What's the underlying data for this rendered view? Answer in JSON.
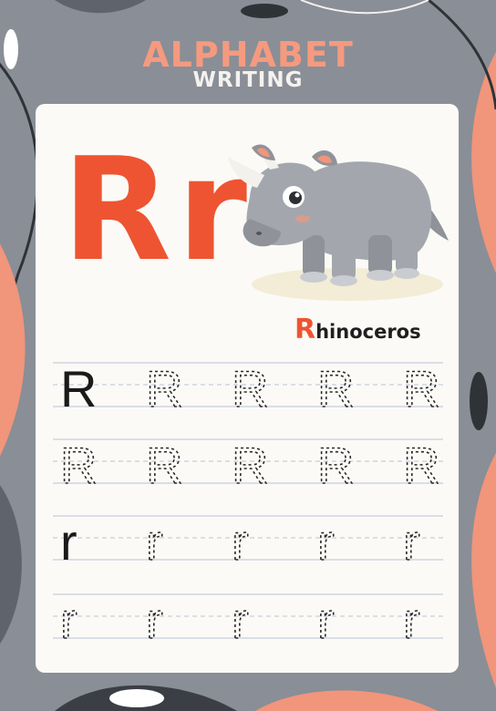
{
  "header": {
    "title": "ALPHABET",
    "subtitle": "WRITING"
  },
  "letters": {
    "upper_lower": "Rr",
    "upper": "R",
    "lower": "r"
  },
  "animal": {
    "word_first": "R",
    "word_rest": "hinoceros"
  },
  "practice": {
    "rows": [
      {
        "letter": "R",
        "solid_first": true
      },
      {
        "letter": "R",
        "solid_first": false
      },
      {
        "letter": "r",
        "solid_first": true
      },
      {
        "letter": "r",
        "solid_first": false
      }
    ]
  },
  "colors": {
    "background": "#8a8e96",
    "accent_orange": "#ee5431",
    "title_salmon": "#f59a7f",
    "card": "#fbfaf6",
    "guide_line": "#cfd4e2"
  }
}
